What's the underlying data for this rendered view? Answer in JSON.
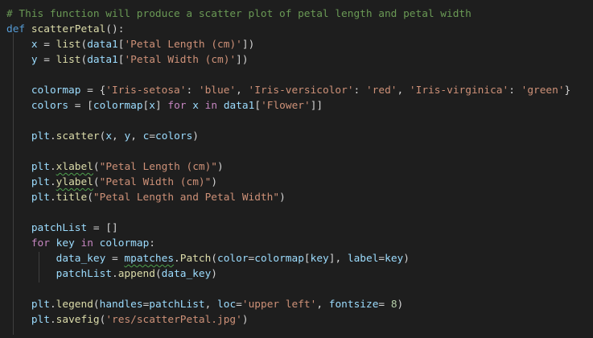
{
  "editor": {
    "theme": "dark",
    "colors": {
      "background": "#1e1e1e",
      "comment": "#6a9955",
      "keyword": "#569cd6",
      "control": "#c586c0",
      "function": "#dcdcaa",
      "variable": "#9cdcfe",
      "string": "#ce9178",
      "number": "#b5cea8",
      "default": "#d4d4d4"
    },
    "lines": [
      {
        "tokens": [
          {
            "t": "cm",
            "v": "# This function will produce a scatter plot of petal length and petal width"
          }
        ]
      },
      {
        "tokens": [
          {
            "t": "kw",
            "v": "def"
          },
          {
            "t": "op",
            "v": " "
          },
          {
            "t": "fn",
            "v": "scatterPetal"
          },
          {
            "t": "op",
            "v": "():"
          }
        ]
      },
      {
        "tokens": [
          {
            "t": "op",
            "v": "    "
          },
          {
            "t": "var",
            "v": "x"
          },
          {
            "t": "op",
            "v": " = "
          },
          {
            "t": "fn",
            "v": "list"
          },
          {
            "t": "op",
            "v": "("
          },
          {
            "t": "var",
            "v": "data1"
          },
          {
            "t": "op",
            "v": "["
          },
          {
            "t": "str",
            "v": "'Petal Length (cm)'"
          },
          {
            "t": "op",
            "v": "])"
          }
        ]
      },
      {
        "tokens": [
          {
            "t": "op",
            "v": "    "
          },
          {
            "t": "var",
            "v": "y"
          },
          {
            "t": "op",
            "v": " = "
          },
          {
            "t": "fn",
            "v": "list"
          },
          {
            "t": "op",
            "v": "("
          },
          {
            "t": "var",
            "v": "data1"
          },
          {
            "t": "op",
            "v": "["
          },
          {
            "t": "str",
            "v": "'Petal Width (cm)'"
          },
          {
            "t": "op",
            "v": "])"
          }
        ]
      },
      {
        "tokens": []
      },
      {
        "tokens": [
          {
            "t": "op",
            "v": "    "
          },
          {
            "t": "var",
            "v": "colormap"
          },
          {
            "t": "op",
            "v": " = {"
          },
          {
            "t": "str",
            "v": "'Iris-setosa'"
          },
          {
            "t": "op",
            "v": ": "
          },
          {
            "t": "str",
            "v": "'blue'"
          },
          {
            "t": "op",
            "v": ", "
          },
          {
            "t": "str",
            "v": "'Iris-versicolor'"
          },
          {
            "t": "op",
            "v": ": "
          },
          {
            "t": "str",
            "v": "'red'"
          },
          {
            "t": "op",
            "v": ", "
          },
          {
            "t": "str",
            "v": "'Iris-virginica'"
          },
          {
            "t": "op",
            "v": ": "
          },
          {
            "t": "str",
            "v": "'green'"
          },
          {
            "t": "op",
            "v": "}"
          }
        ]
      },
      {
        "tokens": [
          {
            "t": "op",
            "v": "    "
          },
          {
            "t": "var",
            "v": "colors"
          },
          {
            "t": "op",
            "v": " = ["
          },
          {
            "t": "var",
            "v": "colormap"
          },
          {
            "t": "op",
            "v": "["
          },
          {
            "t": "var",
            "v": "x"
          },
          {
            "t": "op",
            "v": "] "
          },
          {
            "t": "ctl",
            "v": "for"
          },
          {
            "t": "op",
            "v": " "
          },
          {
            "t": "var",
            "v": "x"
          },
          {
            "t": "op",
            "v": " "
          },
          {
            "t": "ctl",
            "v": "in"
          },
          {
            "t": "op",
            "v": " "
          },
          {
            "t": "var",
            "v": "data1"
          },
          {
            "t": "op",
            "v": "["
          },
          {
            "t": "str",
            "v": "'Flower'"
          },
          {
            "t": "op",
            "v": "]]"
          }
        ]
      },
      {
        "tokens": []
      },
      {
        "tokens": [
          {
            "t": "op",
            "v": "    "
          },
          {
            "t": "var",
            "v": "plt"
          },
          {
            "t": "op",
            "v": "."
          },
          {
            "t": "fn",
            "v": "scatter"
          },
          {
            "t": "op",
            "v": "("
          },
          {
            "t": "var",
            "v": "x"
          },
          {
            "t": "op",
            "v": ", "
          },
          {
            "t": "var",
            "v": "y"
          },
          {
            "t": "op",
            "v": ", "
          },
          {
            "t": "var",
            "v": "c"
          },
          {
            "t": "op",
            "v": "="
          },
          {
            "t": "var",
            "v": "colors"
          },
          {
            "t": "op",
            "v": ")"
          }
        ]
      },
      {
        "tokens": []
      },
      {
        "tokens": [
          {
            "t": "op",
            "v": "    "
          },
          {
            "t": "var",
            "v": "plt"
          },
          {
            "t": "op",
            "v": "."
          },
          {
            "t": "fn",
            "v": "xlabel",
            "sq": true
          },
          {
            "t": "op",
            "v": "("
          },
          {
            "t": "str",
            "v": "\"Petal Length (cm)\""
          },
          {
            "t": "op",
            "v": ")"
          }
        ]
      },
      {
        "tokens": [
          {
            "t": "op",
            "v": "    "
          },
          {
            "t": "var",
            "v": "plt"
          },
          {
            "t": "op",
            "v": "."
          },
          {
            "t": "fn",
            "v": "ylabel",
            "sq": true
          },
          {
            "t": "op",
            "v": "("
          },
          {
            "t": "str",
            "v": "\"Petal Width (cm)\""
          },
          {
            "t": "op",
            "v": ")"
          }
        ]
      },
      {
        "tokens": [
          {
            "t": "op",
            "v": "    "
          },
          {
            "t": "var",
            "v": "plt"
          },
          {
            "t": "op",
            "v": "."
          },
          {
            "t": "fn",
            "v": "title"
          },
          {
            "t": "op",
            "v": "("
          },
          {
            "t": "str",
            "v": "\"Petal Length and Petal Width\""
          },
          {
            "t": "op",
            "v": ")"
          }
        ]
      },
      {
        "tokens": []
      },
      {
        "tokens": [
          {
            "t": "op",
            "v": "    "
          },
          {
            "t": "var",
            "v": "patchList"
          },
          {
            "t": "op",
            "v": " = []"
          }
        ]
      },
      {
        "tokens": [
          {
            "t": "op",
            "v": "    "
          },
          {
            "t": "ctl",
            "v": "for"
          },
          {
            "t": "op",
            "v": " "
          },
          {
            "t": "var",
            "v": "key"
          },
          {
            "t": "op",
            "v": " "
          },
          {
            "t": "ctl",
            "v": "in"
          },
          {
            "t": "op",
            "v": " "
          },
          {
            "t": "var",
            "v": "colormap"
          },
          {
            "t": "op",
            "v": ":"
          }
        ]
      },
      {
        "tokens": [
          {
            "t": "op",
            "v": "        "
          },
          {
            "t": "var",
            "v": "data_key"
          },
          {
            "t": "op",
            "v": " = "
          },
          {
            "t": "var",
            "v": "mpatches",
            "sq": true
          },
          {
            "t": "op",
            "v": "."
          },
          {
            "t": "fn",
            "v": "Patch"
          },
          {
            "t": "op",
            "v": "("
          },
          {
            "t": "var",
            "v": "color"
          },
          {
            "t": "op",
            "v": "="
          },
          {
            "t": "var",
            "v": "colormap"
          },
          {
            "t": "op",
            "v": "["
          },
          {
            "t": "var",
            "v": "key"
          },
          {
            "t": "op",
            "v": "], "
          },
          {
            "t": "var",
            "v": "label"
          },
          {
            "t": "op",
            "v": "="
          },
          {
            "t": "var",
            "v": "key"
          },
          {
            "t": "op",
            "v": ")"
          }
        ]
      },
      {
        "tokens": [
          {
            "t": "op",
            "v": "        "
          },
          {
            "t": "var",
            "v": "patchList"
          },
          {
            "t": "op",
            "v": "."
          },
          {
            "t": "fn",
            "v": "append"
          },
          {
            "t": "op",
            "v": "("
          },
          {
            "t": "var",
            "v": "data_key"
          },
          {
            "t": "op",
            "v": ")"
          }
        ]
      },
      {
        "tokens": []
      },
      {
        "tokens": [
          {
            "t": "op",
            "v": "    "
          },
          {
            "t": "var",
            "v": "plt"
          },
          {
            "t": "op",
            "v": "."
          },
          {
            "t": "fn",
            "v": "legend"
          },
          {
            "t": "op",
            "v": "("
          },
          {
            "t": "var",
            "v": "handles"
          },
          {
            "t": "op",
            "v": "="
          },
          {
            "t": "var",
            "v": "patchList"
          },
          {
            "t": "op",
            "v": ", "
          },
          {
            "t": "var",
            "v": "loc"
          },
          {
            "t": "op",
            "v": "="
          },
          {
            "t": "str",
            "v": "'upper left'"
          },
          {
            "t": "op",
            "v": ", "
          },
          {
            "t": "var",
            "v": "fontsize"
          },
          {
            "t": "op",
            "v": "= "
          },
          {
            "t": "num",
            "v": "8"
          },
          {
            "t": "op",
            "v": ")"
          }
        ]
      },
      {
        "tokens": [
          {
            "t": "op",
            "v": "    "
          },
          {
            "t": "var",
            "v": "plt"
          },
          {
            "t": "op",
            "v": "."
          },
          {
            "t": "fn",
            "v": "savefig"
          },
          {
            "t": "op",
            "v": "("
          },
          {
            "t": "str",
            "v": "'res/scatterPetal.jpg'"
          },
          {
            "t": "op",
            "v": ")"
          }
        ]
      }
    ]
  }
}
